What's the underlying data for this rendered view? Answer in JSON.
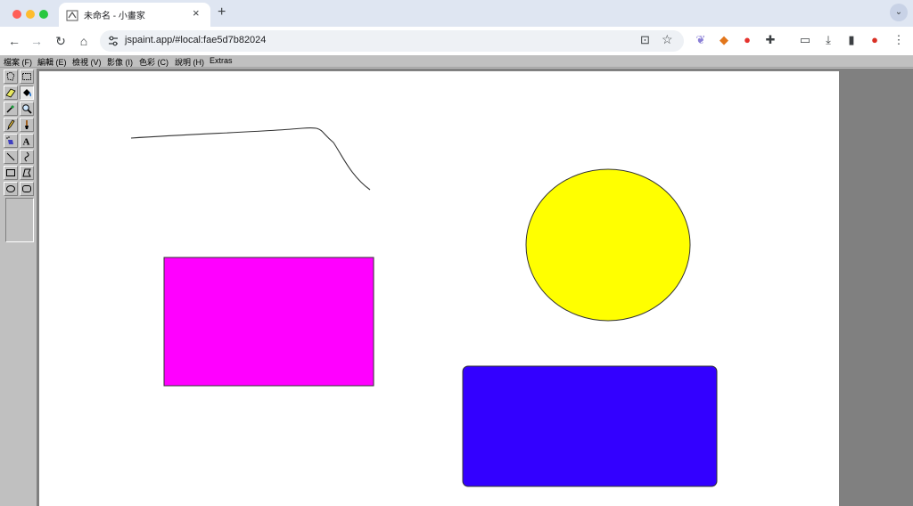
{
  "browser": {
    "tab_title": "未命名 - 小畫家",
    "tab_close": "×",
    "new_tab": "+",
    "tab_menu": "⌄",
    "url": "jspaint.app/#local:fae5d7b82024",
    "nav": {
      "back": "←",
      "forward": "→",
      "reload": "↻",
      "home": "⌂"
    },
    "icons": [
      "install-icon",
      "bookmark-star-icon",
      "extension-icons",
      "cast-icon",
      "download-icon",
      "sidepanel-icon",
      "profile-icon",
      "more-icon"
    ]
  },
  "menubar": {
    "items": [
      {
        "label": "檔案 (F)"
      },
      {
        "label": "編輯 (E)"
      },
      {
        "label": "檢視 (V)"
      },
      {
        "label": "影像 (I)"
      },
      {
        "label": "色彩 (C)"
      },
      {
        "label": "說明 (H)"
      },
      {
        "label": "Extras"
      }
    ]
  },
  "toolbox": {
    "tools": [
      "free-form-select",
      "select",
      "eraser",
      "fill-with-color",
      "pick-color",
      "magnifier",
      "pencil",
      "brush",
      "airbrush",
      "text",
      "line",
      "curve",
      "rectangle",
      "polygon",
      "ellipse",
      "rounded-rectangle"
    ],
    "active_tool": "fill-with-color"
  },
  "canvas": {
    "shapes": [
      {
        "type": "curve",
        "stroke": "#333333"
      },
      {
        "type": "rectangle",
        "fill": "#ff00ff",
        "stroke": "#333333"
      },
      {
        "type": "ellipse",
        "fill": "#ffff00",
        "stroke": "#333333"
      },
      {
        "type": "rounded-rectangle",
        "fill": "#3300ff",
        "stroke": "#333333"
      }
    ]
  }
}
